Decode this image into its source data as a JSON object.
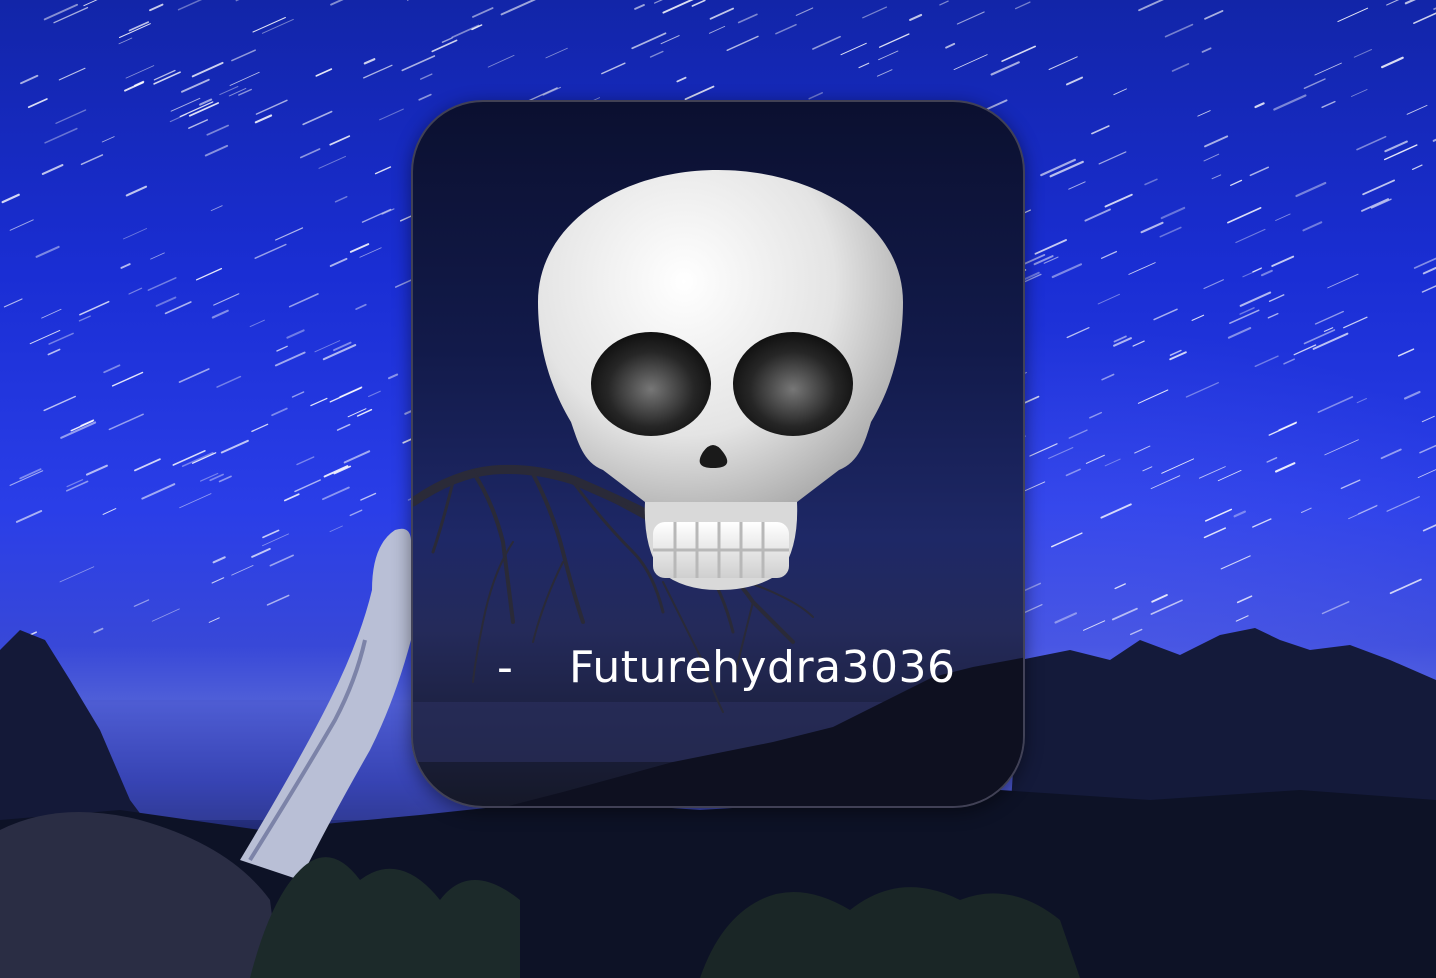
{
  "card": {
    "emoji": "skull-emoji",
    "dash": "-",
    "username": "Futurehydra3036"
  },
  "colors": {
    "sky_top": "#1225a8",
    "sky_mid": "#2a3ee8",
    "card_bg": "#121a4a",
    "caption_text": "#ffffff"
  }
}
